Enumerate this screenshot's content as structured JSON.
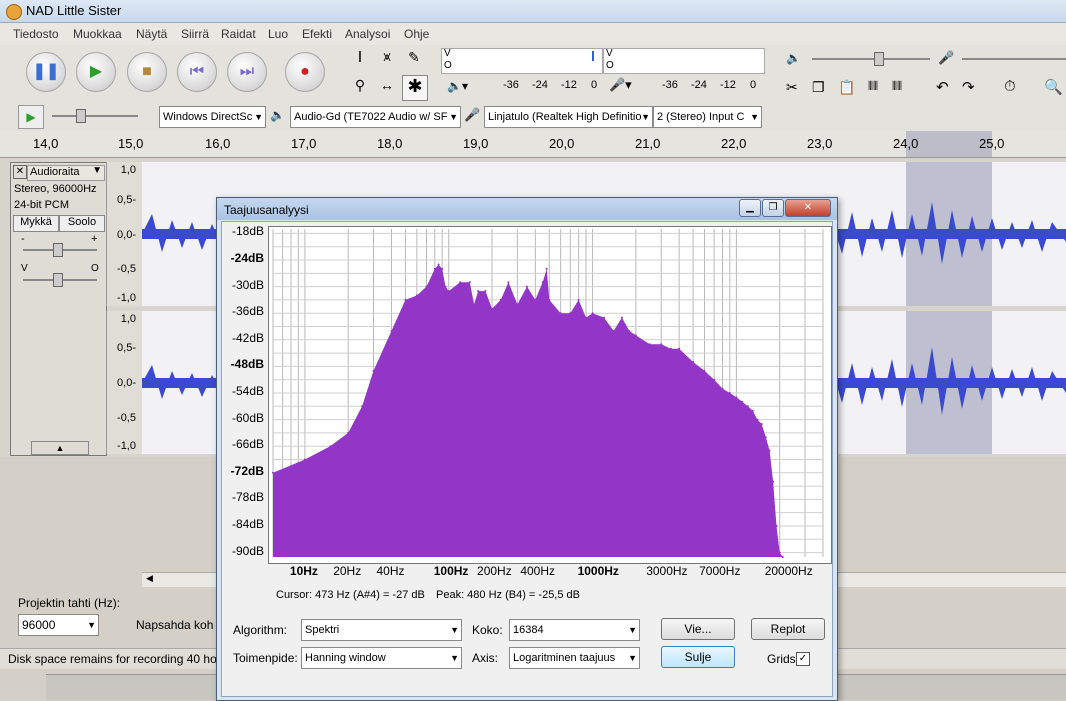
{
  "app": {
    "title": "NAD Little Sister"
  },
  "menu": [
    "Tiedosto",
    "Muokkaa",
    "Näytä",
    "Siirrä",
    "Raidat",
    "Luo",
    "Efekti",
    "Analysoi",
    "Ohje"
  ],
  "meters": {
    "left_letters": [
      "V",
      "O"
    ],
    "right_letters": [
      "V",
      "O"
    ],
    "ticks_play": [
      "-36",
      "-24",
      "-12",
      "0"
    ],
    "ticks_rec": [
      "-36",
      "-24",
      "-12",
      "0"
    ]
  },
  "devices": {
    "host": "Windows DirectSc",
    "output": "Audio-Gd (TE7022 Audio w/ SF",
    "input": "Linjatulo (Realtek High Definitio",
    "channels": "2 (Stereo) Input C"
  },
  "ruler": [
    "14,0",
    "15,0",
    "16,0",
    "17,0",
    "18,0",
    "19,0",
    "20,0",
    "21,0",
    "22,0",
    "23,0",
    "24,0",
    "25,0"
  ],
  "track": {
    "name": "Audioraita",
    "info1": "Stereo, 96000Hz",
    "info2": "24-bit PCM",
    "mute": "Mykkä",
    "solo": "Soolo",
    "gain_minus": "-",
    "gain_plus": "+",
    "pan_left": "V",
    "pan_right": "O",
    "scale": [
      "1,0",
      "0,5-",
      "0,0-",
      "-0,5",
      "-1,0"
    ]
  },
  "status": {
    "rate_label": "Projektin tahti (Hz):",
    "rate": "96000",
    "snap": "Napsahda koh",
    "disk": "Disk space remains for recording 40 hou"
  },
  "dialog": {
    "title": "Taajuusanalyysi",
    "cursor": "Cursor: 473 Hz (A#4) = -27 dB",
    "peak": "Peak: 480 Hz (B4) = -25,5 dB",
    "algorithm_label": "Algorithm:",
    "algorithm": "Spektri",
    "size_label": "Koko:",
    "size": "16384",
    "function_label": "Toimenpide:",
    "function": "Hanning window",
    "axis_label": "Axis:",
    "axis": "Logaritminen taajuus",
    "export": "Vie...",
    "replot": "Replot",
    "close": "Sulje",
    "grids": "Grids",
    "grids_checked": true
  },
  "chart_data": {
    "type": "area",
    "xscale": "log",
    "xlim": [
      6,
      40000
    ],
    "ylim": [
      -91,
      -17
    ],
    "ylabels": [
      "-18dB",
      "-24dB",
      "-30dB",
      "-36dB",
      "-42dB",
      "-48dB",
      "-54dB",
      "-60dB",
      "-66dB",
      "-72dB",
      "-78dB",
      "-84dB",
      "-90dB"
    ],
    "xlabels": [
      "10Hz",
      "20Hz",
      "40Hz",
      "100Hz",
      "200Hz",
      "400Hz",
      "1000Hz",
      "3000Hz",
      "7000Hz",
      "20000Hz"
    ],
    "grid": true,
    "color": "#9336c8",
    "x": [
      6,
      10,
      15,
      20,
      25,
      30,
      40,
      50,
      60,
      70,
      80,
      85,
      90,
      95,
      100,
      120,
      140,
      150,
      160,
      180,
      200,
      230,
      260,
      300,
      350,
      400,
      450,
      480,
      500,
      600,
      700,
      800,
      900,
      1000,
      1200,
      1400,
      1600,
      1800,
      2000,
      2500,
      3000,
      3500,
      4000,
      5000,
      6000,
      7000,
      8000,
      9000,
      10000,
      11000,
      12000,
      13000,
      14000,
      15000,
      16000,
      17000,
      18000,
      19000,
      20000,
      21000
    ],
    "y": [
      -72,
      -69,
      -66,
      -63,
      -57,
      -49,
      -40,
      -33,
      -32,
      -30,
      -26,
      -25,
      -26,
      -30,
      -31,
      -29,
      -29,
      -34,
      -31,
      -31,
      -35,
      -33,
      -29,
      -34,
      -30,
      -33,
      -29,
      -26,
      -33,
      -36,
      -36,
      -33,
      -37,
      -36,
      -37,
      -40,
      -37,
      -40,
      -41,
      -43,
      -43,
      -44,
      -44,
      -47,
      -49,
      -51,
      -53,
      -54,
      -55,
      -56,
      -57,
      -58,
      -60,
      -61,
      -64,
      -67,
      -74,
      -84,
      -90,
      -91
    ]
  }
}
